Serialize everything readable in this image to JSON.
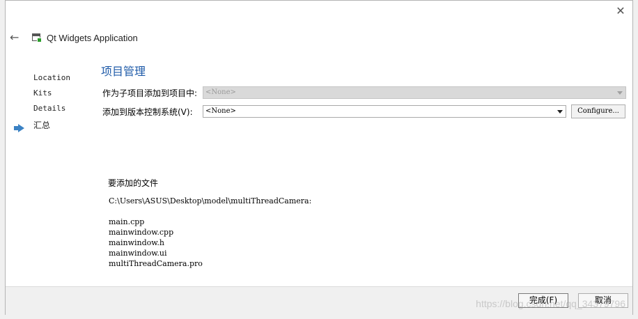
{
  "window": {
    "close_glyph": "✕"
  },
  "header": {
    "back_glyph": "←",
    "title": "Qt Widgets Application"
  },
  "steps": [
    {
      "label": "Location",
      "current": false
    },
    {
      "label": "Kits",
      "current": false
    },
    {
      "label": "Details",
      "current": false
    },
    {
      "label": "汇总",
      "current": true
    }
  ],
  "page": {
    "title": "项目管理",
    "subproject_label": "作为子项目添加到项目中:",
    "subproject_value": "<None>",
    "vcs_label": "添加到版本控制系统(V):",
    "vcs_value": "<None>",
    "configure_label": "Configure..."
  },
  "files": {
    "heading": "要添加的文件",
    "path": "C:\\Users\\ASUS\\Desktop\\model\\multiThreadCamera:",
    "items": [
      "main.cpp",
      "mainwindow.cpp",
      "mainwindow.h",
      "mainwindow.ui",
      "multiThreadCamera.pro"
    ]
  },
  "footer": {
    "finish_label": "完成(F)",
    "cancel_label": "取消"
  },
  "watermark": "https://blog.csdn.net/qq_34379796",
  "icons": {
    "close": "close-icon",
    "back": "back-arrow-icon",
    "wizard": "qt-widgets-app-icon",
    "current_step": "current-step-arrow-icon",
    "dropdown": "chevron-down-icon"
  },
  "colors": {
    "accent": "#1e5aa8",
    "step_arrow": "#3b82c4"
  }
}
